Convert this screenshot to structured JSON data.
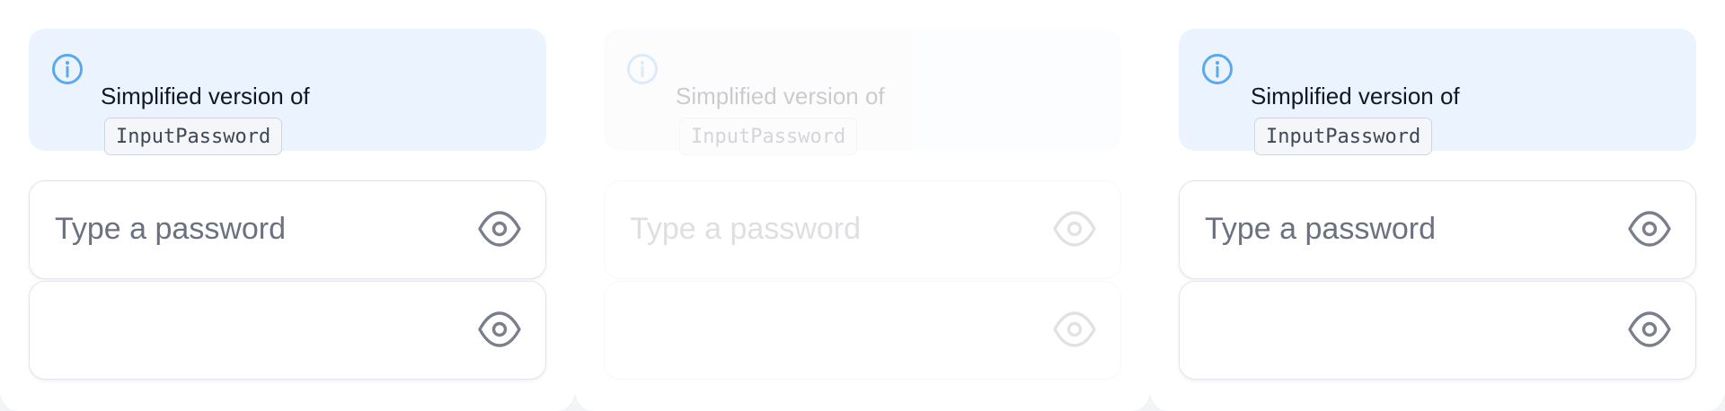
{
  "panels": [
    {
      "state": "normal",
      "callout": {
        "text": "Simplified version of",
        "code": "InputPassword",
        "icon": "info-icon"
      },
      "fields": [
        {
          "placeholder": "Type a password",
          "value": "",
          "icon": "eye-icon"
        },
        {
          "placeholder": "",
          "value": "",
          "icon": "eye-icon"
        }
      ]
    },
    {
      "state": "disabled",
      "callout": {
        "text": "Simplified version of",
        "code": "InputPassword",
        "icon": "info-icon"
      },
      "fields": [
        {
          "placeholder": "Type a password",
          "value": "",
          "icon": "eye-icon"
        },
        {
          "placeholder": "",
          "value": "",
          "icon": "eye-icon"
        }
      ]
    },
    {
      "state": "normal",
      "callout": {
        "text": "Simplified version of",
        "code": "InputPassword",
        "icon": "info-icon"
      },
      "fields": [
        {
          "placeholder": "Type a password",
          "value": "",
          "icon": "eye-icon"
        },
        {
          "placeholder": "",
          "value": "",
          "icon": "eye-icon"
        }
      ]
    }
  ],
  "colors": {
    "info_accent": "#5aa9f0",
    "callout_bg": "#ebf4fe",
    "icon_gray": "#7a7f8c",
    "placeholder": "#6b7180"
  }
}
